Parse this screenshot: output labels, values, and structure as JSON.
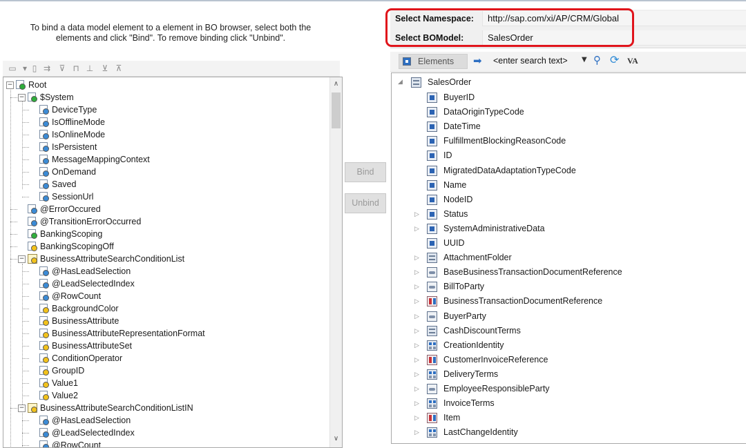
{
  "instructions": "To bind a data model element to a element in BO browser, select both the elements and click \"Bind\". To remove binding click \"Unbind\".",
  "left_toolbar": {
    "icons": [
      "new-icon",
      "delete-icon",
      "move-icon",
      "filter-icon",
      "hierarchy-icon",
      "tree-icon",
      "expand-all-icon",
      "collapse-all-icon"
    ]
  },
  "left_tree": {
    "root": "Root",
    "items": [
      {
        "label": "$System",
        "icon": "folder-node"
      },
      {
        "label": "DeviceType",
        "icon": "blue-field"
      },
      {
        "label": "IsOfflineMode",
        "icon": "blue-field"
      },
      {
        "label": "IsOnlineMode",
        "icon": "blue-field"
      },
      {
        "label": "IsPersistent",
        "icon": "blue-field"
      },
      {
        "label": "MessageMappingContext",
        "icon": "blue-field"
      },
      {
        "label": "OnDemand",
        "icon": "blue-field"
      },
      {
        "label": "Saved",
        "icon": "blue-field"
      },
      {
        "label": "SessionUrl",
        "icon": "blue-field"
      },
      {
        "label": "@ErrorOccured",
        "icon": "blue-field"
      },
      {
        "label": "@TransitionErrorOccurred",
        "icon": "blue-field"
      },
      {
        "label": "BankingScoping",
        "icon": "green-field"
      },
      {
        "label": "BankingScopingOff",
        "icon": "yellow-field"
      },
      {
        "label": "BusinessAttributeSearchConditionList",
        "icon": "list-node"
      },
      {
        "label": "@HasLeadSelection",
        "icon": "blue-field"
      },
      {
        "label": "@LeadSelectedIndex",
        "icon": "blue-field"
      },
      {
        "label": "@RowCount",
        "icon": "blue-field"
      },
      {
        "label": "BackgroundColor",
        "icon": "yellow-field"
      },
      {
        "label": "BusinessAttribute",
        "icon": "yellow-field"
      },
      {
        "label": "BusinessAttributeRepresentationFormat",
        "icon": "yellow-field"
      },
      {
        "label": "BusinessAttributeSet",
        "icon": "yellow-field"
      },
      {
        "label": "ConditionOperator",
        "icon": "yellow-field"
      },
      {
        "label": "GroupID",
        "icon": "yellow-field"
      },
      {
        "label": "Value1",
        "icon": "yellow-field"
      },
      {
        "label": "Value2",
        "icon": "yellow-field"
      },
      {
        "label": "BusinessAttributeSearchConditionListIN",
        "icon": "list-node"
      },
      {
        "label": "@HasLeadSelection",
        "icon": "blue-field"
      },
      {
        "label": "@LeadSelectedIndex",
        "icon": "blue-field"
      },
      {
        "label": "@RowCount",
        "icon": "blue-field"
      }
    ]
  },
  "buttons": {
    "bind": "Bind",
    "unbind": "Unbind"
  },
  "namespace": {
    "ns_label": "Select Namespace:",
    "ns_value": "http://sap.com/xi/AP/CRM/Global",
    "bo_label": "Select BOModel:",
    "bo_value": "SalesOrder"
  },
  "right_toolbar": {
    "elements_label": "Elements",
    "search_placeholder": "<enter search text>",
    "va_label": "VA"
  },
  "right_tree": {
    "root": "SalesOrder",
    "items": [
      {
        "label": "BuyerID",
        "icon": "attr",
        "expandable": false
      },
      {
        "label": "DataOriginTypeCode",
        "icon": "attr",
        "expandable": false
      },
      {
        "label": "DateTime",
        "icon": "attr",
        "expandable": false
      },
      {
        "label": "FulfillmentBlockingReasonCode",
        "icon": "attr",
        "expandable": false
      },
      {
        "label": "ID",
        "icon": "attr",
        "expandable": false
      },
      {
        "label": "MigratedDataAdaptationTypeCode",
        "icon": "attr",
        "expandable": false
      },
      {
        "label": "Name",
        "icon": "attr",
        "expandable": false
      },
      {
        "label": "NodeID",
        "icon": "attr",
        "expandable": false
      },
      {
        "label": "Status",
        "icon": "attr",
        "expandable": true
      },
      {
        "label": "SystemAdministrativeData",
        "icon": "attr",
        "expandable": true
      },
      {
        "label": "UUID",
        "icon": "attr",
        "expandable": false
      },
      {
        "label": "AttachmentFolder",
        "icon": "node",
        "expandable": true
      },
      {
        "label": "BaseBusinessTransactionDocumentReference",
        "icon": "assoc",
        "expandable": true
      },
      {
        "label": "BillToParty",
        "icon": "assoc",
        "expandable": true
      },
      {
        "label": "BusinessTransactionDocumentReference",
        "icon": "assoc-red",
        "expandable": true
      },
      {
        "label": "BuyerParty",
        "icon": "assoc",
        "expandable": true
      },
      {
        "label": "CashDiscountTerms",
        "icon": "node",
        "expandable": true
      },
      {
        "label": "CreationIdentity",
        "icon": "dual",
        "expandable": true
      },
      {
        "label": "CustomerInvoiceReference",
        "icon": "assoc-red",
        "expandable": true
      },
      {
        "label": "DeliveryTerms",
        "icon": "dual",
        "expandable": true
      },
      {
        "label": "EmployeeResponsibleParty",
        "icon": "assoc",
        "expandable": true
      },
      {
        "label": "InvoiceTerms",
        "icon": "dual",
        "expandable": true
      },
      {
        "label": "Item",
        "icon": "assoc-red",
        "expandable": true
      },
      {
        "label": "LastChangeIdentity",
        "icon": "dual",
        "expandable": true
      }
    ]
  },
  "colors": {
    "highlight": "#e0141b",
    "accent": "#2d6fc2"
  }
}
